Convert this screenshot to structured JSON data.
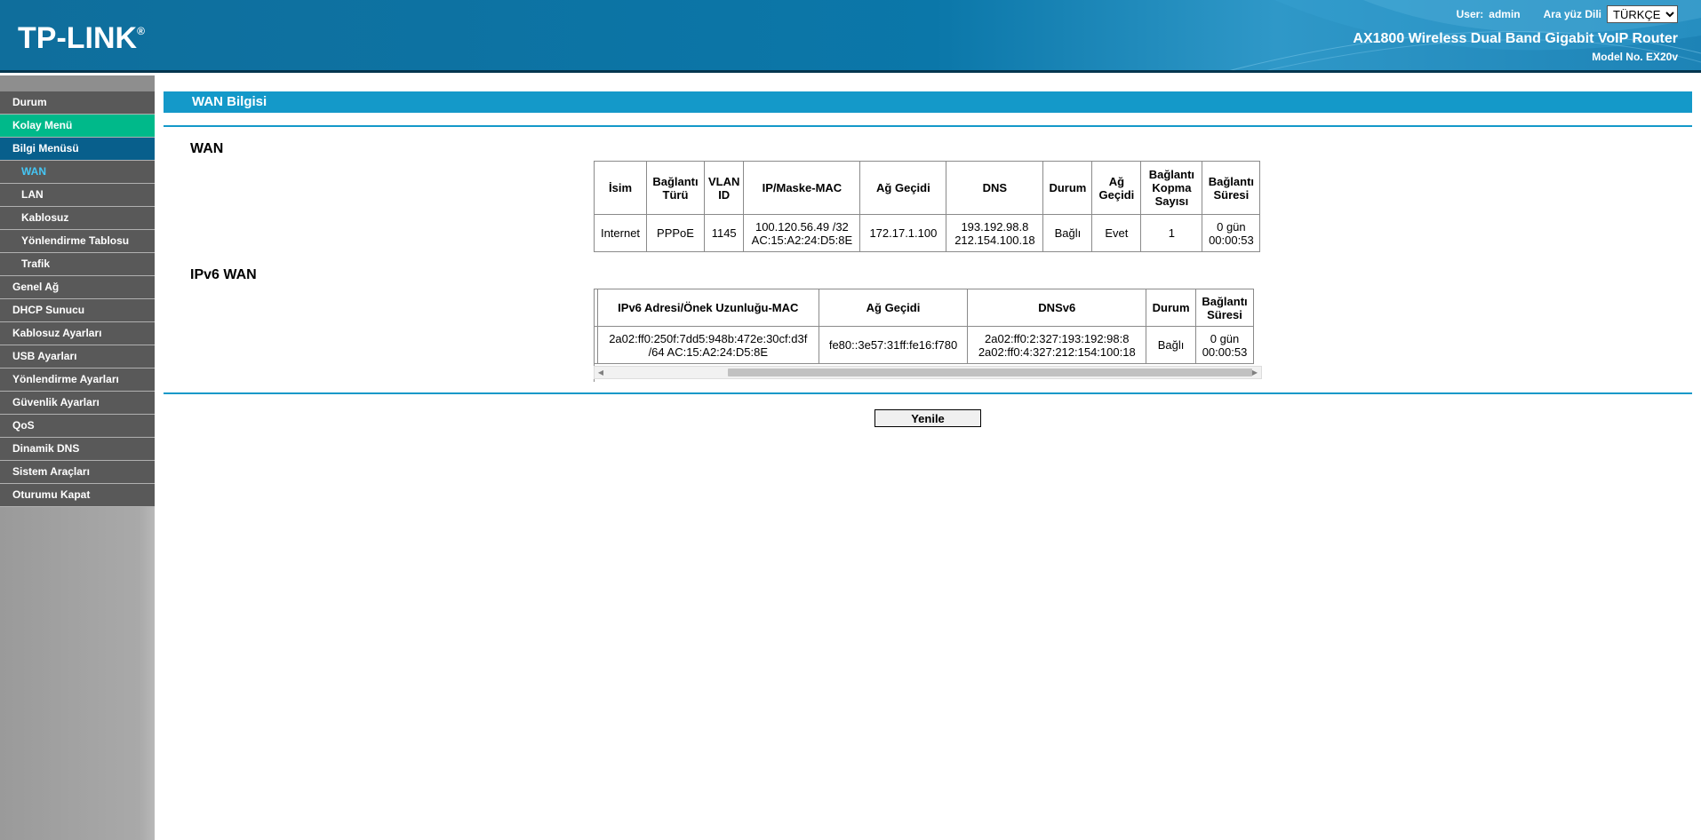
{
  "header": {
    "logo_text": "TP-LINK",
    "logo_mark": "®",
    "user_label": "User:",
    "user_name": "admin",
    "language_label": "Ara yüz Dili",
    "language_value": "TÜRKÇE",
    "product_name": "AX1800 Wireless Dual Band Gigabit VoIP Router",
    "model_no": "Model No. EX20v"
  },
  "sidebar": {
    "items": [
      {
        "label": "Durum"
      },
      {
        "label": "Kolay Menü"
      },
      {
        "label": "Bilgi Menüsü"
      },
      {
        "label": "WAN"
      },
      {
        "label": "LAN"
      },
      {
        "label": "Kablosuz"
      },
      {
        "label": "Yönlendirme Tablosu"
      },
      {
        "label": "Trafik"
      },
      {
        "label": "Genel Ağ"
      },
      {
        "label": "DHCP Sunucu"
      },
      {
        "label": "Kablosuz Ayarları"
      },
      {
        "label": "USB Ayarları"
      },
      {
        "label": "Yönlendirme Ayarları"
      },
      {
        "label": "Güvenlik Ayarları"
      },
      {
        "label": "QoS"
      },
      {
        "label": "Dinamik DNS"
      },
      {
        "label": "Sistem Araçları"
      },
      {
        "label": "Oturumu Kapat"
      }
    ]
  },
  "main": {
    "page_title": "WAN Bilgisi",
    "wan_section_title": "WAN",
    "wan_headers": [
      "İsim",
      "Bağlantı Türü",
      "VLAN ID",
      "IP/Maske-MAC",
      "Ağ Geçidi",
      "DNS",
      "Durum",
      "Ağ Geçidi",
      "Bağlantı Kopma Sayısı",
      "Bağlantı Süresi"
    ],
    "wan_row": {
      "name": "Internet",
      "type": "PPPoE",
      "vlan": "1145",
      "ip_mask": "100.120.56.49 /32",
      "mac": "AC:15:A2:24:D5:8E",
      "gateway": "172.17.1.100",
      "dns1": "193.192.98.8",
      "dns2": "212.154.100.18",
      "status": "Bağlı",
      "default_gw": "Evet",
      "disconnects": "1",
      "uptime_days": "0 gün",
      "uptime_time": "00:00:53"
    },
    "ipv6_section_title": "IPv6 WAN",
    "ipv6_headers": [
      "IPv6 Adresi/Önek Uzunluğu-MAC",
      "Ağ Geçidi",
      "DNSv6",
      "Durum",
      "Bağlantı Süresi"
    ],
    "ipv6_row": {
      "addr_line1": "2a02:ff0:250f:7dd5:948b:472e:30cf:d3f",
      "addr_line2": "/64 AC:15:A2:24:D5:8E",
      "gateway": "fe80::3e57:31ff:fe16:f780",
      "dns1": "2a02:ff0:2:327:193:192:98:8",
      "dns2": "2a02:ff0:4:327:212:154:100:18",
      "status": "Bağlı",
      "uptime_days": "0 gün",
      "uptime_time": "00:00:53"
    },
    "refresh_label": "Yenile"
  }
}
